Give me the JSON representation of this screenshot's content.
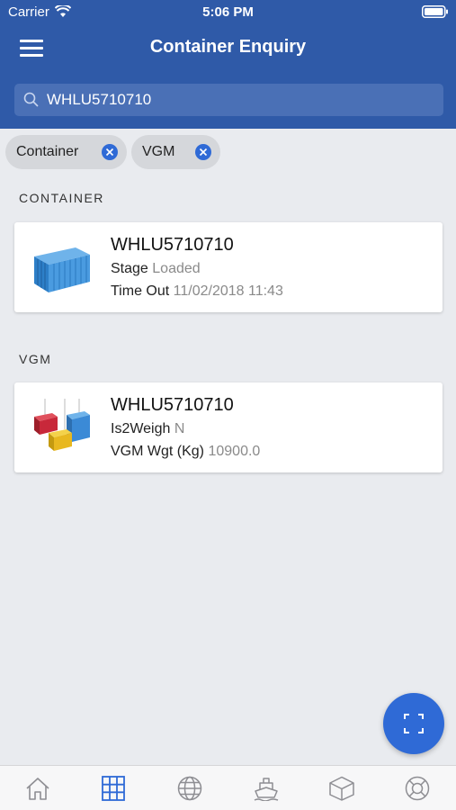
{
  "status_bar": {
    "carrier": "Carrier",
    "time": "5:06 PM"
  },
  "header": {
    "title": "Container Enquiry"
  },
  "search": {
    "value": "WHLU5710710"
  },
  "filters": [
    {
      "label": "Container"
    },
    {
      "label": "VGM"
    }
  ],
  "sections": {
    "container": {
      "title": "CONTAINER",
      "card": {
        "title": "WHLU5710710",
        "lines": [
          {
            "label": "Stage",
            "value": "Loaded"
          },
          {
            "label": "Time Out",
            "value": "11/02/2018 11:43"
          }
        ]
      }
    },
    "vgm": {
      "title": "VGM",
      "card": {
        "title": "WHLU5710710",
        "lines": [
          {
            "label": "Is2Weigh",
            "value": "N"
          },
          {
            "label": "VGM Wgt (Kg)",
            "value": "10900.0"
          }
        ]
      }
    }
  },
  "tabs": [
    {
      "icon": "home-icon"
    },
    {
      "icon": "grid-icon",
      "active": true
    },
    {
      "icon": "globe-icon"
    },
    {
      "icon": "ship-icon"
    },
    {
      "icon": "box-icon"
    },
    {
      "icon": "lifebuoy-icon"
    }
  ],
  "colors": {
    "primary": "#2f5aa8",
    "accent": "#2f6ad6",
    "tab_active": "#2f6ad6",
    "tab_inactive": "#8e8e93"
  }
}
